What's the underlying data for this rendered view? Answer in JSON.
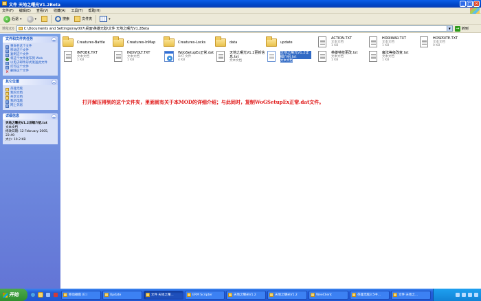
{
  "window": {
    "title": "文件 天地之曙光V1.2Beta"
  },
  "menu": [
    "文件(F)",
    "编辑(E)",
    "查看(V)",
    "收藏(A)",
    "工具(T)",
    "帮助(H)"
  ],
  "toolbar": {
    "back_label": "后退",
    "search_label": "搜索",
    "folders_label": "文件夹"
  },
  "address": {
    "label": "地址(D)",
    "value": "C:\\Documents and Settings\\ray007\\桌面\\英雄无敌\\文件 天地之曙光V1.2Beta",
    "go_label": "转到"
  },
  "left": {
    "tasks_title": "文件和文件夹任务",
    "tasks": [
      {
        "label": "重命名这个文件",
        "icon": "rename-icon"
      },
      {
        "label": "移动这个文件",
        "icon": "move-icon"
      },
      {
        "label": "复制这个文件",
        "icon": "copy-icon"
      },
      {
        "label": "将这个文件发布到 Web",
        "icon": "globe-icon"
      },
      {
        "label": "以电子邮件形式发送此文件",
        "icon": "email-icon"
      },
      {
        "label": "打印这个文件",
        "icon": "print-icon"
      },
      {
        "label": "删除这个文件",
        "icon": "delete-icon"
      }
    ],
    "places_title": "其它位置",
    "places": [
      {
        "label": "英雄无敌",
        "icon": "folder-icon"
      },
      {
        "label": "我的文档",
        "icon": "documents-icon"
      },
      {
        "label": "共享文档",
        "icon": "shared-folder-icon"
      },
      {
        "label": "我的电脑",
        "icon": "computer-icon"
      },
      {
        "label": "网上邻居",
        "icon": "network-icon"
      }
    ],
    "details_title": "详细信息",
    "details": {
      "name": "天地之曙光V1.2详细介绍.txt",
      "type": "文本文档",
      "modified": "修改日期: 12 February 2005, 22:49",
      "size": "大小: 10.2 KB"
    }
  },
  "items": [
    {
      "kind": "folder",
      "name": "Creatures-Battle",
      "line1": "",
      "line2": ""
    },
    {
      "kind": "folder",
      "name": "Creatures-InMap",
      "line1": "",
      "line2": ""
    },
    {
      "kind": "folder",
      "name": "Creatures-Locks",
      "line1": "",
      "line2": ""
    },
    {
      "kind": "folder",
      "name": "data",
      "line1": "",
      "line2": ""
    },
    {
      "kind": "folder",
      "name": "update",
      "line1": "",
      "line2": ""
    },
    {
      "kind": "file",
      "name": "ACTION.TXT",
      "line1": "文本文档",
      "line2": "1 KB"
    },
    {
      "kind": "file",
      "name": "HORIWAR.TXT",
      "line1": "文本文档",
      "line2": "1 KB"
    },
    {
      "kind": "file",
      "name": "HOSPRITE.TXT",
      "line1": "文本文档",
      "line2": "0 KB"
    },
    {
      "kind": "file",
      "name": "INFOBK.TXT",
      "line1": "文本文档",
      "line2": "1 KB"
    },
    {
      "kind": "file",
      "name": "INDIVOLT.TXT",
      "line1": "文本文档",
      "line2": "1 KB"
    },
    {
      "kind": "exe",
      "name": "WoGSetupEx正常.dat",
      "line1": "DAT 文件",
      "line2": "4 KB"
    },
    {
      "kind": "file",
      "name": "天地之曙光V1.2更新信息.txt",
      "line1": "文本文档",
      "line2": "",
      "two_line_name": true
    },
    {
      "kind": "file",
      "name": "天地之曙光V1.2详细介绍.txt",
      "line1": "文本文档",
      "line2": "",
      "two_line_name": true,
      "selected": true
    },
    {
      "kind": "file",
      "name": "英雄特技更改.txt",
      "line1": "文本文档",
      "line2": "1 KB"
    },
    {
      "kind": "file",
      "name": "魔法等级改变.txt",
      "line1": "文本文档",
      "line2": "1 KB"
    }
  ],
  "note": "打开解压得到的这个文件夹，里面就有关于本MOD的详细介绍；与此同时，复制WoGSetupEx正常.dat文件。",
  "taskbar": {
    "start_label": "开始",
    "tasks": [
      {
        "label": "移动磁盘 (E:)",
        "active": false
      },
      {
        "label": "Update",
        "active": false
      },
      {
        "label": "文件 天地之曙...",
        "active": true
      },
      {
        "label": "ERM Scripter",
        "active": false
      },
      {
        "label": "天地之曙光V1.2",
        "active": false
      },
      {
        "label": "天地之曙光V1.2",
        "active": false
      },
      {
        "label": "WeeClient",
        "active": false
      },
      {
        "label": "英雄无敌3.5中...",
        "active": false
      },
      {
        "label": "文件 天地之...",
        "active": false
      }
    ]
  }
}
